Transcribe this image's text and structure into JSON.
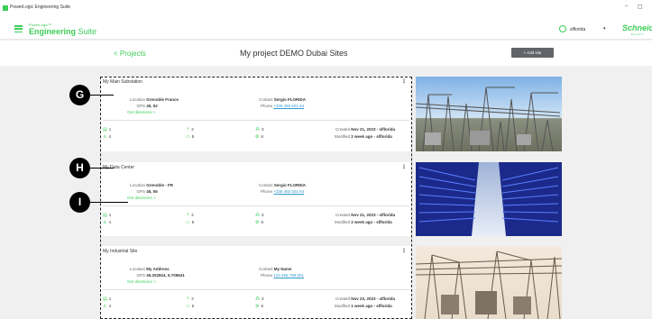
{
  "window": {
    "title": "PowerLogic Engineering Suite",
    "minimize": "–",
    "maximize": "◻"
  },
  "header": {
    "brand_small": "PowerLogic™",
    "brand_bold": "Engineering",
    "brand_light": " Suite",
    "user": "slflorida",
    "user_caret": "▾",
    "logo": "Schneider",
    "logo_sub": "Electric"
  },
  "subbar": {
    "back": "< Projects",
    "title": "My project DEMO Dubai Sites",
    "add_site": "+   Add site"
  },
  "annotations": [
    {
      "letter": "G"
    },
    {
      "letter": "H"
    },
    {
      "letter": "I"
    }
  ],
  "labels": {
    "location": "Location",
    "gps": "GPS",
    "contact": "Contact",
    "phone": "Phone",
    "directions": "Get directions  >",
    "created": "Created",
    "modified": "Modified",
    "menu": "⋮"
  },
  "sites": [
    {
      "name": "My Main Substation",
      "location": "Grenoble France",
      "gps": "45, 52",
      "contact": "Sergio FLORIDA",
      "phone": "+336 450 501 64",
      "stats": [
        "1",
        "2",
        "3",
        "4",
        "5",
        "6"
      ],
      "created": "Nov 21, 2023 - slflorida",
      "modified": "2 week ago - slflorida"
    },
    {
      "name": "My Data Center",
      "location": "Grenoble - FR",
      "gps": "45, 55",
      "contact": "Sergio FLORIDA",
      "phone": "+336 450 501 64",
      "stats": [
        "1",
        "2",
        "3",
        "4",
        "5",
        "6"
      ],
      "created": "Nov 21, 2023 - slflorida",
      "modified": "2 week ago - slflorida"
    },
    {
      "name": "My Industrial Site",
      "location": "My Address",
      "gps": "45.202824, 5.709641",
      "contact": "My Name",
      "phone": "123 456 789 001",
      "stats": [
        "1",
        "2",
        "3",
        "4",
        "5",
        "6"
      ],
      "created": "Nov 23, 2023 - slflorida",
      "modified": "1 week ago - slflorida"
    }
  ],
  "stat_icons": [
    "switchboard-icon",
    "transformer-icon",
    "network-icon",
    "users-icon",
    "device-icon",
    "settings-icon"
  ],
  "colors": {
    "accent": "#3dcd58",
    "link": "#3399cc",
    "button": "#626469"
  }
}
